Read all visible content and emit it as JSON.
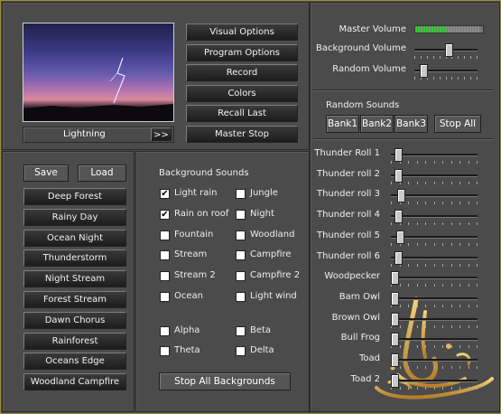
{
  "preview": {
    "caption": "Lightning",
    "nav_label": ">>"
  },
  "menu_buttons": [
    "Visual Options",
    "Program Options",
    "Record",
    "Colors",
    "Recall Last",
    "Master Stop"
  ],
  "save_label": "Save",
  "load_label": "Load",
  "presets": [
    "Deep Forest",
    "Rainy Day",
    "Ocean Night",
    "Thunderstorm",
    "Night Stream",
    "Forest Stream",
    "Dawn Chorus",
    "Rainforest",
    "Oceans Edge",
    "Woodland Campfire"
  ],
  "background_sounds": {
    "title": "Background Sounds",
    "left": [
      {
        "label": "Light rain",
        "checked": true
      },
      {
        "label": "Rain on roof",
        "checked": true
      },
      {
        "label": "Fountain",
        "checked": false
      },
      {
        "label": "Stream",
        "checked": false
      },
      {
        "label": "Stream 2",
        "checked": false
      },
      {
        "label": "Ocean",
        "checked": false
      }
    ],
    "right": [
      {
        "label": "Jungle",
        "checked": false
      },
      {
        "label": "Night",
        "checked": false
      },
      {
        "label": "Woodland",
        "checked": false
      },
      {
        "label": "Campfire",
        "checked": false
      },
      {
        "label": "Campfire 2",
        "checked": false
      },
      {
        "label": "Light wind",
        "checked": false
      }
    ],
    "waves_left": [
      {
        "label": "Alpha",
        "checked": false
      },
      {
        "label": "Theta",
        "checked": false
      }
    ],
    "waves_right": [
      {
        "label": "Beta",
        "checked": false
      },
      {
        "label": "Delta",
        "checked": false
      }
    ],
    "stop_all_label": "Stop All Backgrounds"
  },
  "volumes": {
    "master": {
      "label": "Master Volume",
      "level": 0.5
    },
    "background": {
      "label": "Background Volume",
      "level": 0.55
    },
    "random": {
      "label": "Random Volume",
      "level": 0.1
    }
  },
  "random_sounds": {
    "title": "Random Sounds",
    "banks": [
      "Bank1",
      "Bank2",
      "Bank3"
    ],
    "stop_all_label": "Stop All",
    "sliders": [
      {
        "label": "Thunder Roll 1",
        "level": 0.05
      },
      {
        "label": "Thunder roll 2",
        "level": 0.05
      },
      {
        "label": "Thunder roll 3",
        "level": 0.08
      },
      {
        "label": "Thunder roll 4",
        "level": 0.05
      },
      {
        "label": "Thunder roll 5",
        "level": 0.07
      },
      {
        "label": "Thunder roll 6",
        "level": 0.05
      },
      {
        "label": "Woodpecker",
        "level": 0.0
      },
      {
        "label": "Barn Owl",
        "level": 0.0
      },
      {
        "label": "Brown Owl",
        "level": 0.0
      },
      {
        "label": "Bull Frog",
        "level": 0.0
      },
      {
        "label": "Toad",
        "level": 0.0
      },
      {
        "label": "Toad 2",
        "level": 0.0
      }
    ]
  },
  "watermark": {
    "text": "العنابي سارق",
    "color": "#c8a24a"
  }
}
